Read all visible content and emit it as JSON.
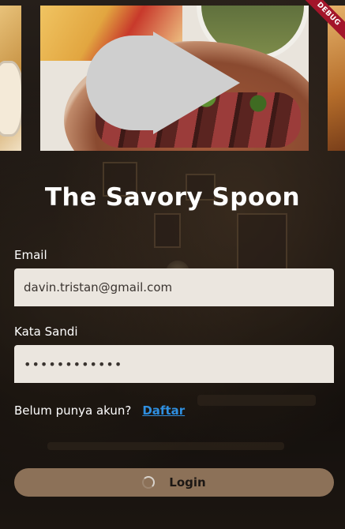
{
  "app": {
    "title": "The Savory Spoon",
    "debug_banner": "DEBUG"
  },
  "carousel": {
    "center_icon": "play-icon",
    "slides": [
      "side-dish",
      "steak-plate",
      "side-dish"
    ]
  },
  "form": {
    "email_label": "Email",
    "email_value": "davin.tristan@gmail.com",
    "password_label": "Kata Sandi",
    "password_value": "••••••••••••",
    "signup_prompt": "Belum punya akun?",
    "signup_link": "Daftar",
    "login_label": "Login",
    "login_loading_icon": "spinner-icon"
  },
  "colors": {
    "button_bg": "#8c7158",
    "field_bg": "#ebe6df",
    "link": "#2f8fe0",
    "debug": "#a3152a"
  }
}
